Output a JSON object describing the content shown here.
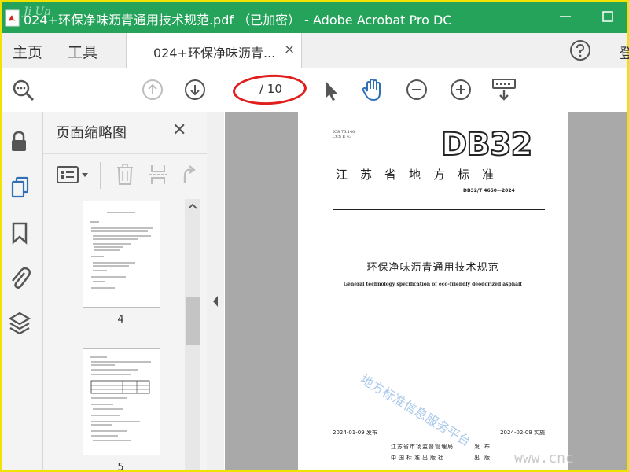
{
  "window": {
    "title": "024+环保净味沥青通用技术规范.pdf （已加密） - Adobe Acrobat Pro DC",
    "watermark": "Ji  Ua"
  },
  "menubar": {
    "home": "主页",
    "tools": "工具",
    "doc_tab": "024+环保净味沥青...",
    "close_glyph": "×",
    "login_partial": "登"
  },
  "toolbar": {
    "page_current": "",
    "page_total": "/ 10"
  },
  "thumbnails_panel": {
    "title": "页面缩略图",
    "close_glyph": "✕",
    "pages": [
      {
        "number": "4"
      },
      {
        "number": "5"
      }
    ]
  },
  "document": {
    "header_left": [
      "ICS 75.140",
      "CCS E 43"
    ],
    "logo": "DB32",
    "province_standard": "江苏省地方标准",
    "standard_number": "DB32/T 4650—2024",
    "title_cn": "环保净味沥青通用技术规范",
    "title_en": "General technology specification of eco-friendly deodorized asphalt",
    "watermark": "地方标准信息服务平台",
    "issue_date": "2024-01-09 发布",
    "effective_date": "2024-02-09 实施",
    "publisher_1": "江苏省市场监督管理局",
    "publisher_2": "中国标准出版社",
    "publisher_1_verb": "发布",
    "publisher_2_verb": "出版"
  },
  "overlay_watermark": "www.cnc",
  "colors": {
    "titlebar": "#25a35a",
    "accent_blue": "#2f6fb8",
    "annotation_ring": "#e01e1e",
    "frame": "#f2e200"
  }
}
